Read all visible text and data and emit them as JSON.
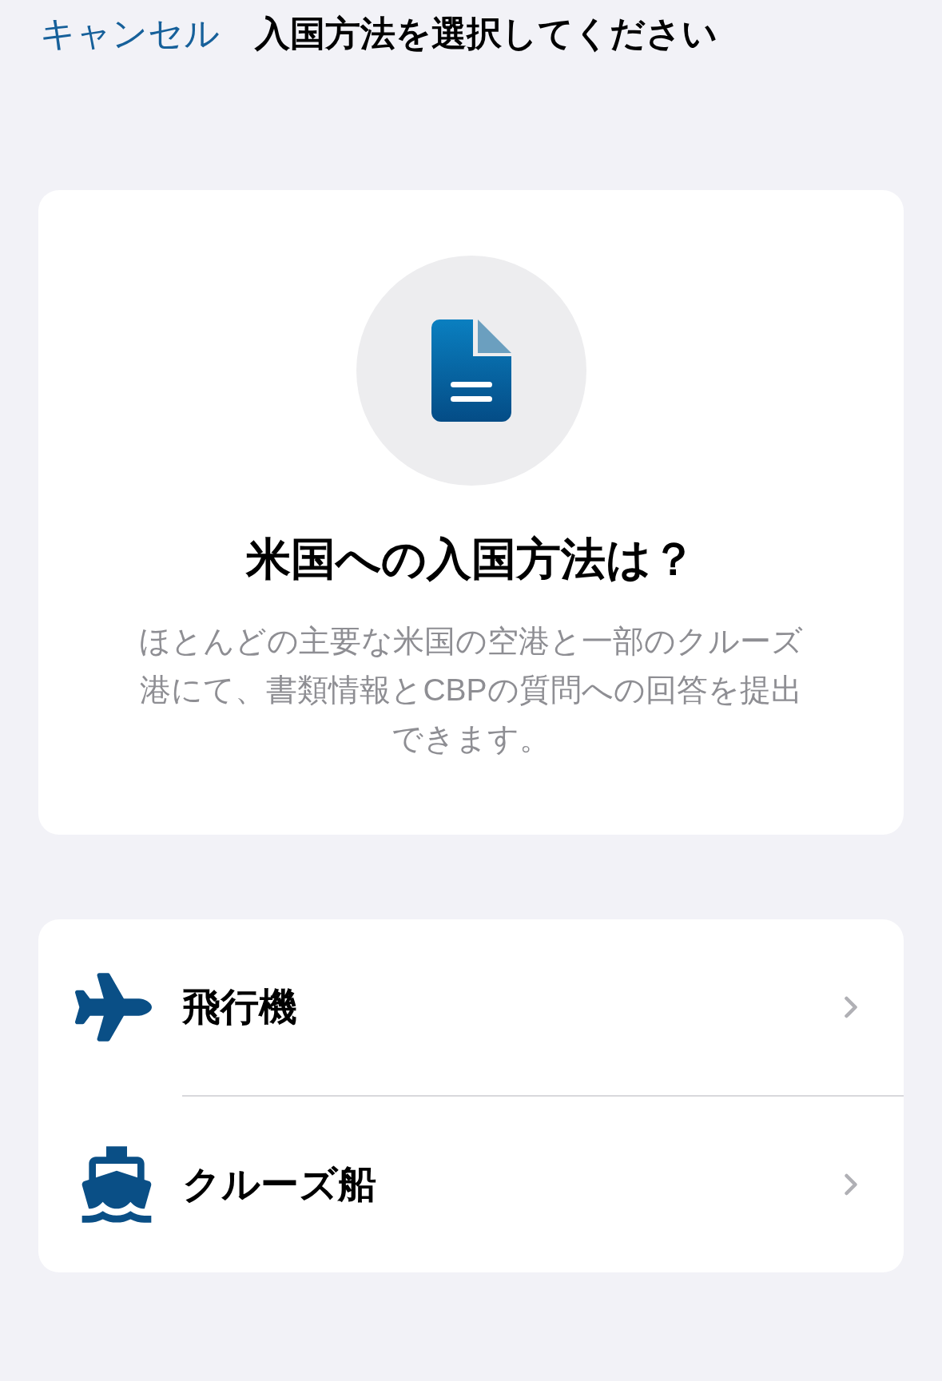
{
  "header": {
    "cancel": "キャンセル",
    "title": "入国方法を選択してください"
  },
  "intro": {
    "heading": "米国への入国方法は？",
    "description": "ほとんどの主要な米国の空港と一部のクルーズ港にて、書類情報とCBPの質問への回答を提出できます。"
  },
  "options": [
    {
      "kind": "plane",
      "label": "飛行機"
    },
    {
      "kind": "ship",
      "label": "クルーズ船"
    }
  ]
}
